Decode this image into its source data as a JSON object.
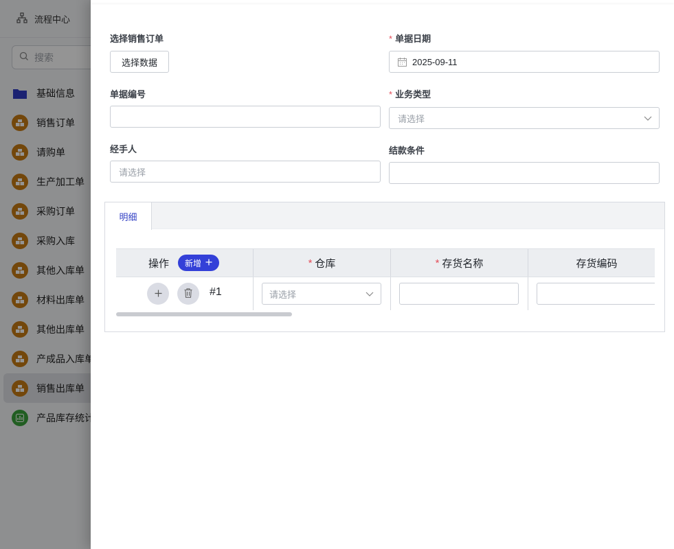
{
  "sidebar": {
    "top_label": "流程中心",
    "search_placeholder": "搜索",
    "items": [
      {
        "label": "基础信息",
        "icon": "folder-icon"
      },
      {
        "label": "销售订单",
        "icon": "cube-stack-icon"
      },
      {
        "label": "请购单",
        "icon": "cube-stack-icon"
      },
      {
        "label": "生产加工单",
        "icon": "cube-stack-icon"
      },
      {
        "label": "采购订单",
        "icon": "cube-stack-icon"
      },
      {
        "label": "采购入库",
        "icon": "cube-stack-icon"
      },
      {
        "label": "其他入库单",
        "icon": "cube-stack-icon"
      },
      {
        "label": "材料出库单",
        "icon": "cube-stack-icon"
      },
      {
        "label": "其他出库单",
        "icon": "cube-stack-icon"
      },
      {
        "label": "产成品入库单",
        "icon": "cube-stack-icon"
      },
      {
        "label": "销售出库单",
        "icon": "cube-stack-icon",
        "active": true
      },
      {
        "label": "产品库存统计",
        "icon": "chart-icon"
      }
    ]
  },
  "form": {
    "sales_order": {
      "label": "选择销售订单",
      "button": "选择数据"
    },
    "doc_date": {
      "label": "单据日期",
      "value": "2025-09-11"
    },
    "doc_number": {
      "label": "单据编号",
      "value": ""
    },
    "business_type": {
      "label": "业务类型",
      "placeholder": "请选择"
    },
    "handler": {
      "label": "经手人",
      "placeholder": "请选择"
    },
    "payment_terms": {
      "label": "结款条件",
      "value": ""
    }
  },
  "detail": {
    "tab_label": "明细",
    "columns": [
      {
        "label": "操作",
        "required": false
      },
      {
        "label": "仓库",
        "required": true
      },
      {
        "label": "存货名称",
        "required": true
      },
      {
        "label": "存货编码",
        "required": false
      }
    ],
    "add_button": "新增",
    "rows": [
      {
        "index": "#1",
        "warehouse_placeholder": "请选择",
        "item_name": "",
        "item_code": ""
      }
    ]
  },
  "colors": {
    "accent": "#3340d8",
    "required": "#e34d59",
    "icon_orange": "#c77a14",
    "icon_green": "#3aa33c"
  }
}
